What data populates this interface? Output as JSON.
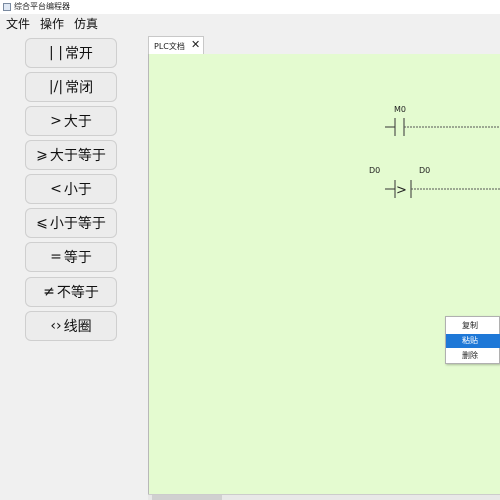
{
  "window": {
    "title": "综合平台编程器"
  },
  "menu": [
    "文件",
    "操作",
    "仿真"
  ],
  "palette": [
    {
      "symbol": "| |",
      "label": "常开"
    },
    {
      "symbol": "|/|",
      "label": "常闭"
    },
    {
      "symbol": ">",
      "label": "大于"
    },
    {
      "symbol": "⩾",
      "label": "大于等于"
    },
    {
      "symbol": "<",
      "label": "小于"
    },
    {
      "symbol": "⩽",
      "label": "小于等于"
    },
    {
      "symbol": "=",
      "label": "等于"
    },
    {
      "symbol": "≠",
      "label": "不等于"
    },
    {
      "symbol": "‹›",
      "label": "线圈"
    }
  ],
  "tab": {
    "label": "PLC文档",
    "close": "✕"
  },
  "ladder": {
    "rung1": {
      "contact_label": "M0"
    },
    "rung2": {
      "operand1": "D0",
      "operand2": "D0",
      "operator": ">"
    }
  },
  "context_menu": {
    "items": [
      "复制",
      "粘贴",
      "删除"
    ],
    "highlighted_index": 1
  },
  "colors": {
    "canvas": "#e4fbd0",
    "highlight": "#1e78d7"
  }
}
